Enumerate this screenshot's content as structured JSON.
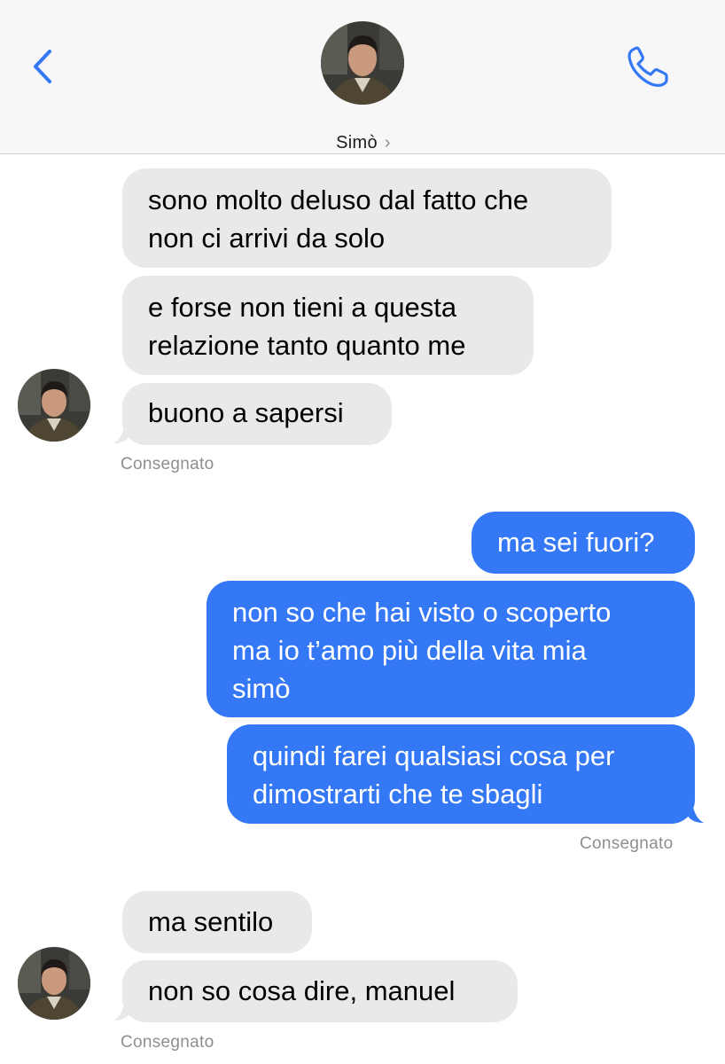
{
  "header": {
    "contact_name": "Simò",
    "chevron": "›",
    "back_icon": "chevron-left-icon",
    "call_icon": "phone-icon",
    "accent_color": "#3478f6"
  },
  "messages": [
    {
      "side": "received",
      "text": "sono molto deluso dal fatto che\nnon ci arrivi da solo"
    },
    {
      "side": "received",
      "text": "e forse non tieni a questa\nrelazione tanto quanto me"
    },
    {
      "side": "received",
      "text": "buono a sapersi"
    },
    {
      "side": "sent",
      "text": "ma sei fuori?"
    },
    {
      "side": "sent",
      "text": "non so che hai visto o scoperto\nma io t’amo più della vita mia\nsimò"
    },
    {
      "side": "sent",
      "text": "quindi farei qualsiasi cosa per\ndimostrarti che te sbagli"
    },
    {
      "side": "received",
      "text": "ma sentilo"
    },
    {
      "side": "received",
      "text": "non so cosa dire, manuel"
    }
  ],
  "statuses": [
    "Consegnato",
    "Consegnato",
    "Consegnato"
  ],
  "colors": {
    "sent_bubble": "#3478f6",
    "received_bubble": "#e9e9eb",
    "status_text": "#8e8e93"
  }
}
